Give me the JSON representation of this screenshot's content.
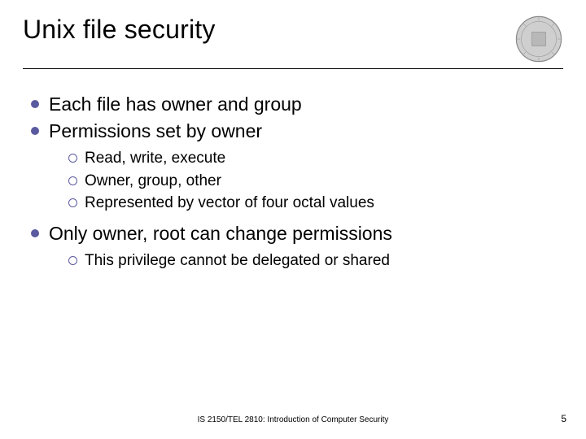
{
  "title": "Unix file security",
  "bullets": {
    "b0": {
      "text": "Each file has owner and group"
    },
    "b1": {
      "text": "Permissions set by owner",
      "sub": {
        "s0": "Read, write, execute",
        "s1": "Owner, group, other",
        "s2": "Represented by vector of four octal values"
      }
    },
    "b2": {
      "text": "Only owner, root can change permissions",
      "sub": {
        "s0": "This privilege cannot be delegated or shared"
      }
    }
  },
  "footer": {
    "course": "IS 2150/TEL 2810: Introduction of Computer Security",
    "page": "5"
  }
}
